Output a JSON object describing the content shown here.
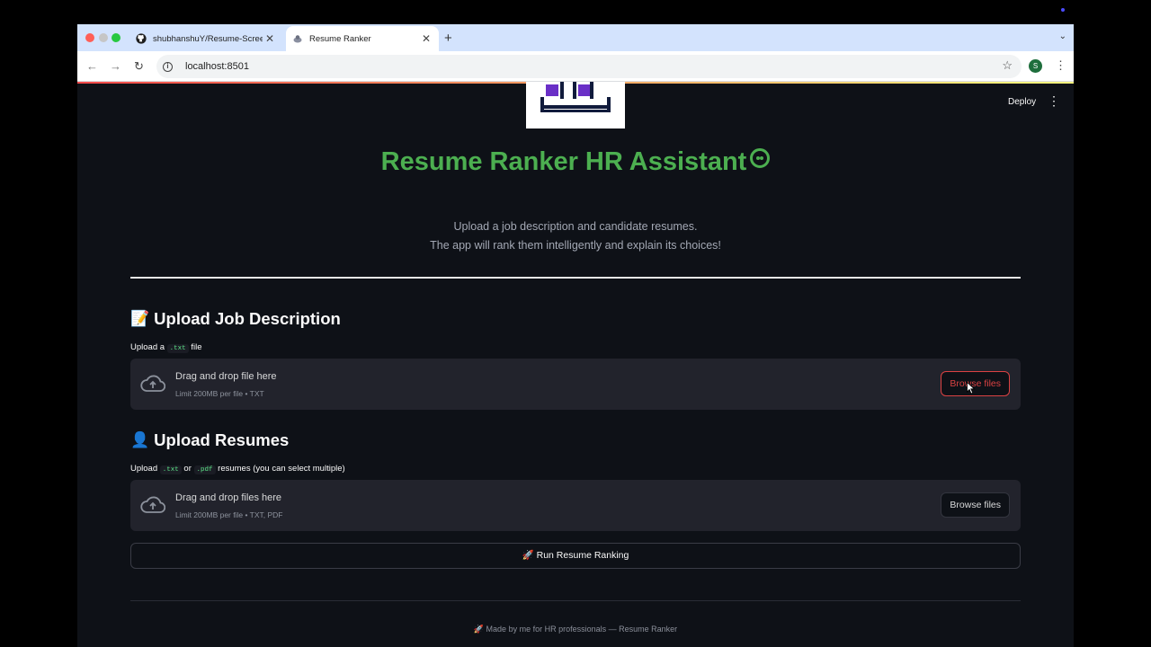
{
  "browser": {
    "tabs": [
      {
        "title": "shubhanshuY/Resume-Screen",
        "icon": "github-icon",
        "active": false
      },
      {
        "title": "Resume Ranker",
        "icon": "streamlit-icon",
        "active": true
      }
    ],
    "url": "localhost:8501",
    "profile_initial": "S"
  },
  "app": {
    "deploy_label": "Deploy",
    "title": "Resume Ranker HR Assistant",
    "subtitle_line1": "Upload a job description and candidate resumes.",
    "subtitle_line2": "The app will rank them intelligently and explain its choices!",
    "job_section": {
      "emoji": "📝",
      "heading": "Upload Job Description",
      "hint_prefix": "Upload a",
      "hint_code": ".txt",
      "hint_suffix": "file",
      "drop_title": "Drag and drop file here",
      "drop_limit": "Limit 200MB per file • TXT",
      "browse_label": "Browse files"
    },
    "resume_section": {
      "emoji": "👤",
      "heading": "Upload Resumes",
      "hint_prefix": "Upload",
      "hint_code1": ".txt",
      "hint_or": "or",
      "hint_code2": ".pdf",
      "hint_suffix": "resumes (you can select multiple)",
      "drop_title": "Drag and drop files here",
      "drop_limit": "Limit 200MB per file • TXT, PDF",
      "browse_label": "Browse files"
    },
    "run_button_label": "🚀 Run Resume Ranking",
    "footer": "🚀 Made by me for HR professionals — Resume Ranker"
  },
  "colors": {
    "accent_green": "#4caf50",
    "streamlit_red": "#ff4b4b",
    "app_bg": "#0e1117"
  }
}
